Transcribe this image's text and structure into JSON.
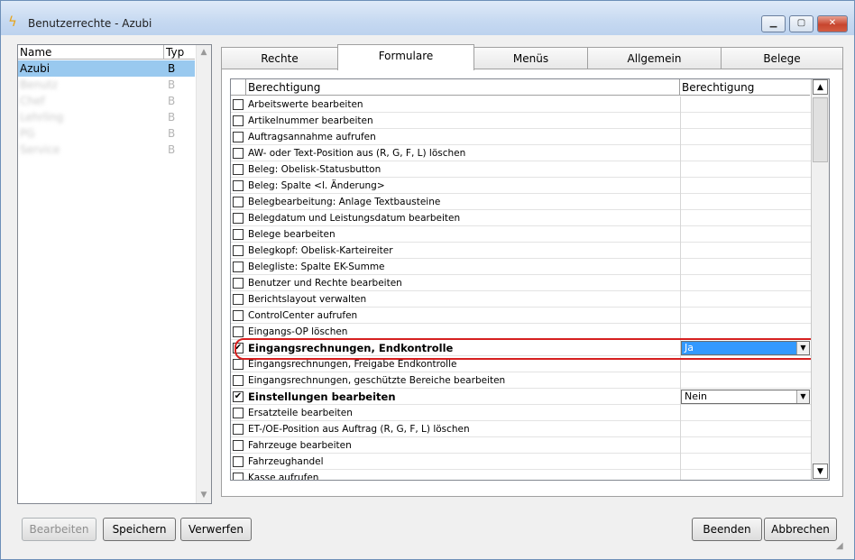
{
  "window": {
    "title": "Benutzerrechte - Azubi",
    "minimize_glyph": "▁",
    "maximize_glyph": "▢",
    "close_glyph": "✕",
    "app_icon": "lightning-icon"
  },
  "userlist": {
    "col_name": "Name",
    "col_typ": "Typ",
    "rows": [
      {
        "name": "Azubi",
        "typ": "B",
        "selected": true
      },
      {
        "name": "Benutz",
        "typ": "B"
      },
      {
        "name": "Chef",
        "typ": "B"
      },
      {
        "name": "Lehrling",
        "typ": "B"
      },
      {
        "name": "PG",
        "typ": "B"
      },
      {
        "name": "Service",
        "typ": "B"
      }
    ]
  },
  "tabs": [
    {
      "label": "Rechte"
    },
    {
      "label": "Formulare",
      "active": true
    },
    {
      "label": "Menüs"
    },
    {
      "label": "Allgemein"
    },
    {
      "label": "Belege"
    }
  ],
  "grid": {
    "col1": "Berechtigung",
    "col2": "Berechtigung",
    "rows": [
      {
        "label": "Arbeitswerte bearbeiten",
        "checked": false
      },
      {
        "label": "Artikelnummer bearbeiten",
        "checked": false
      },
      {
        "label": "Auftragsannahme aufrufen",
        "checked": false
      },
      {
        "label": "AW- oder Text-Position aus (R, G, F, L) löschen",
        "checked": false
      },
      {
        "label": "Beleg: Obelisk-Statusbutton",
        "checked": false
      },
      {
        "label": "Beleg: Spalte <l. Änderung>",
        "checked": false
      },
      {
        "label": "Belegbearbeitung: Anlage Textbausteine",
        "checked": false
      },
      {
        "label": "Belegdatum und Leistungsdatum bearbeiten",
        "checked": false
      },
      {
        "label": "Belege bearbeiten",
        "checked": false
      },
      {
        "label": "Belegkopf: Obelisk-Karteireiter",
        "checked": false
      },
      {
        "label": "Belegliste: Spalte EK-Summe",
        "checked": false
      },
      {
        "label": "Benutzer und Rechte bearbeiten",
        "checked": false
      },
      {
        "label": "Berichtslayout verwalten",
        "checked": false
      },
      {
        "label": "ControlCenter aufrufen",
        "checked": false
      },
      {
        "label": "Eingangs-OP löschen",
        "checked": false
      },
      {
        "label": "Eingangsrechnungen, Endkontrolle",
        "checked": true,
        "value": "Ja",
        "dropdown": "selected"
      },
      {
        "label": "Eingangsrechnungen, Freigabe Endkontrolle",
        "checked": false
      },
      {
        "label": "Eingangsrechnungen, geschützte Bereiche bearbeiten",
        "checked": false
      },
      {
        "label": "Einstellungen bearbeiten",
        "checked": true,
        "value": "Nein",
        "dropdown": "normal"
      },
      {
        "label": "Ersatzteile bearbeiten",
        "checked": false
      },
      {
        "label": "ET-/OE-Position aus Auftrag (R, G, F, L) löschen",
        "checked": false
      },
      {
        "label": "Fahrzeuge bearbeiten",
        "checked": false
      },
      {
        "label": "Fahrzeughandel",
        "checked": false
      },
      {
        "label": "Kasse aufrufen",
        "checked": false
      }
    ],
    "check_glyph": "✔",
    "arrow_glyph": "▼",
    "scroll_up": "▲",
    "scroll_down": "▼"
  },
  "buttons": {
    "bearbeiten": "Bearbeiten",
    "speichern": "Speichern",
    "verwerfen": "Verwerfen",
    "beenden": "Beenden",
    "abbrechen": "Abbrechen"
  },
  "colors": {
    "selection": "#99c9ef",
    "dropdown_selected": "#3399ff",
    "highlight_ring": "#d62020"
  }
}
